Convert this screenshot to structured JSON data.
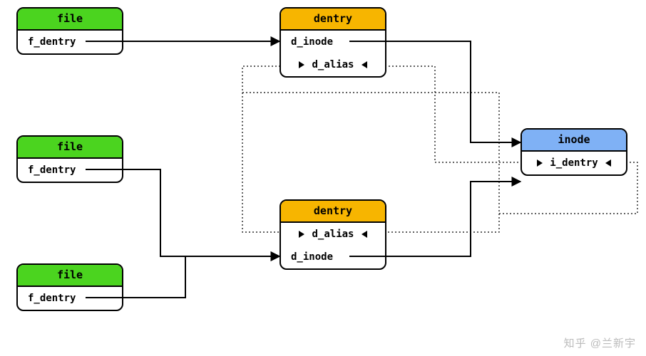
{
  "file1": {
    "title": "file",
    "field": "f_dentry"
  },
  "file2": {
    "title": "file",
    "field": "f_dentry"
  },
  "file3": {
    "title": "file",
    "field": "f_dentry"
  },
  "dentry1": {
    "title": "dentry",
    "d_inode": "d_inode",
    "d_alias": "d_alias"
  },
  "dentry2": {
    "title": "dentry",
    "d_inode": "d_inode",
    "d_alias": "d_alias"
  },
  "inode": {
    "title": "inode",
    "i_dentry": "i_dentry"
  },
  "watermark": "知乎 @兰新宇"
}
